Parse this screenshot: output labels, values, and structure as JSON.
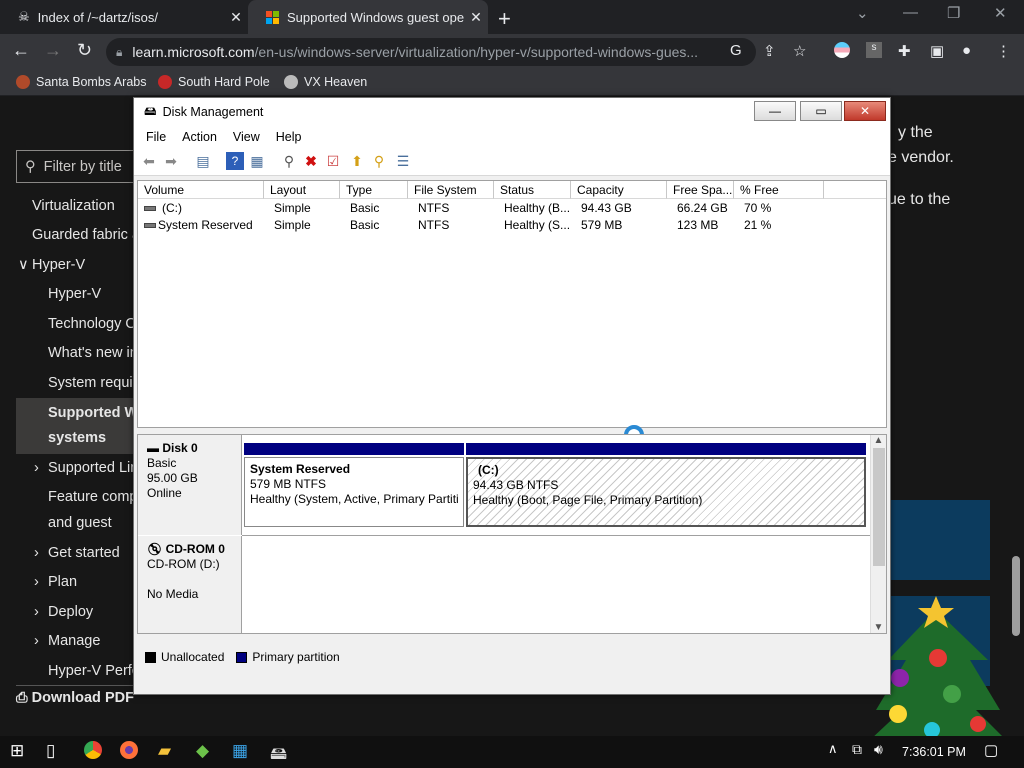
{
  "browser": {
    "tabs": [
      {
        "title": "Index of /~dartz/isos/",
        "close": "✕"
      },
      {
        "title": "Supported Windows guest opera",
        "close": "✕"
      }
    ],
    "new_tab": "+",
    "url_host": "learn.microsoft.com",
    "url_path": "/en-us/windows-server/virtualization/hyper-v/supported-windows-gues...",
    "bookmarks": [
      "Santa Bombs Arabs",
      "South Hard Pole",
      "VX Heaven"
    ]
  },
  "page": {
    "filter_placeholder": "Filter by title",
    "nav": [
      {
        "label": "Virtualization"
      },
      {
        "label": "Guarded fabric a"
      },
      {
        "label": "Hyper-V",
        "prefix": "∨"
      },
      {
        "label": "Hyper-V"
      },
      {
        "label": "Technology O"
      },
      {
        "label": "What's new in"
      },
      {
        "label": "System requir"
      },
      {
        "label": "Supported W"
      },
      {
        "label": "systems"
      },
      {
        "label": "Supported Lin",
        "prefix": "›"
      },
      {
        "label": "Feature comp"
      },
      {
        "label": "and guest"
      },
      {
        "label": "Get started",
        "prefix": "›"
      },
      {
        "label": "Plan",
        "prefix": "›"
      },
      {
        "label": "Deploy",
        "prefix": "›"
      },
      {
        "label": "Manage",
        "prefix": "›"
      },
      {
        "label": "Hyper-V Perfo"
      }
    ],
    "download_pdf": "Download PDF",
    "right_text": [
      "y the",
      "e vendor.",
      "ue to the"
    ]
  },
  "disk_mgmt": {
    "title": "Disk Management",
    "menu": [
      "File",
      "Action",
      "View",
      "Help"
    ],
    "columns": [
      "Volume",
      "Layout",
      "Type",
      "File System",
      "Status",
      "Capacity",
      "Free Spa...",
      "% Free"
    ],
    "rows": [
      [
        "(C:)",
        "Simple",
        "Basic",
        "NTFS",
        "Healthy (B...",
        "94.43 GB",
        "66.24 GB",
        "70 %"
      ],
      [
        "System Reserved",
        "Simple",
        "Basic",
        "NTFS",
        "Healthy (S...",
        "579 MB",
        "123 MB",
        "21 %"
      ]
    ],
    "disks": [
      {
        "name": "Disk 0",
        "type": "Basic",
        "size": "95.00 GB",
        "state": "Online",
        "partitions": [
          {
            "name": "System Reserved",
            "size": "579 MB NTFS",
            "status": "Healthy (System, Active, Primary Partiti"
          },
          {
            "name": "(C:)",
            "size": "94.43 GB NTFS",
            "status": "Healthy (Boot, Page File, Primary Partition)"
          }
        ]
      },
      {
        "name": "CD-ROM 0",
        "type": "CD-ROM (D:)",
        "state": "No Media"
      }
    ],
    "legend": [
      {
        "label": "Unallocated",
        "color": "#000000"
      },
      {
        "label": "Primary partition",
        "color": "#000080"
      }
    ]
  },
  "taskbar": {
    "time": "7:36:01 PM"
  }
}
